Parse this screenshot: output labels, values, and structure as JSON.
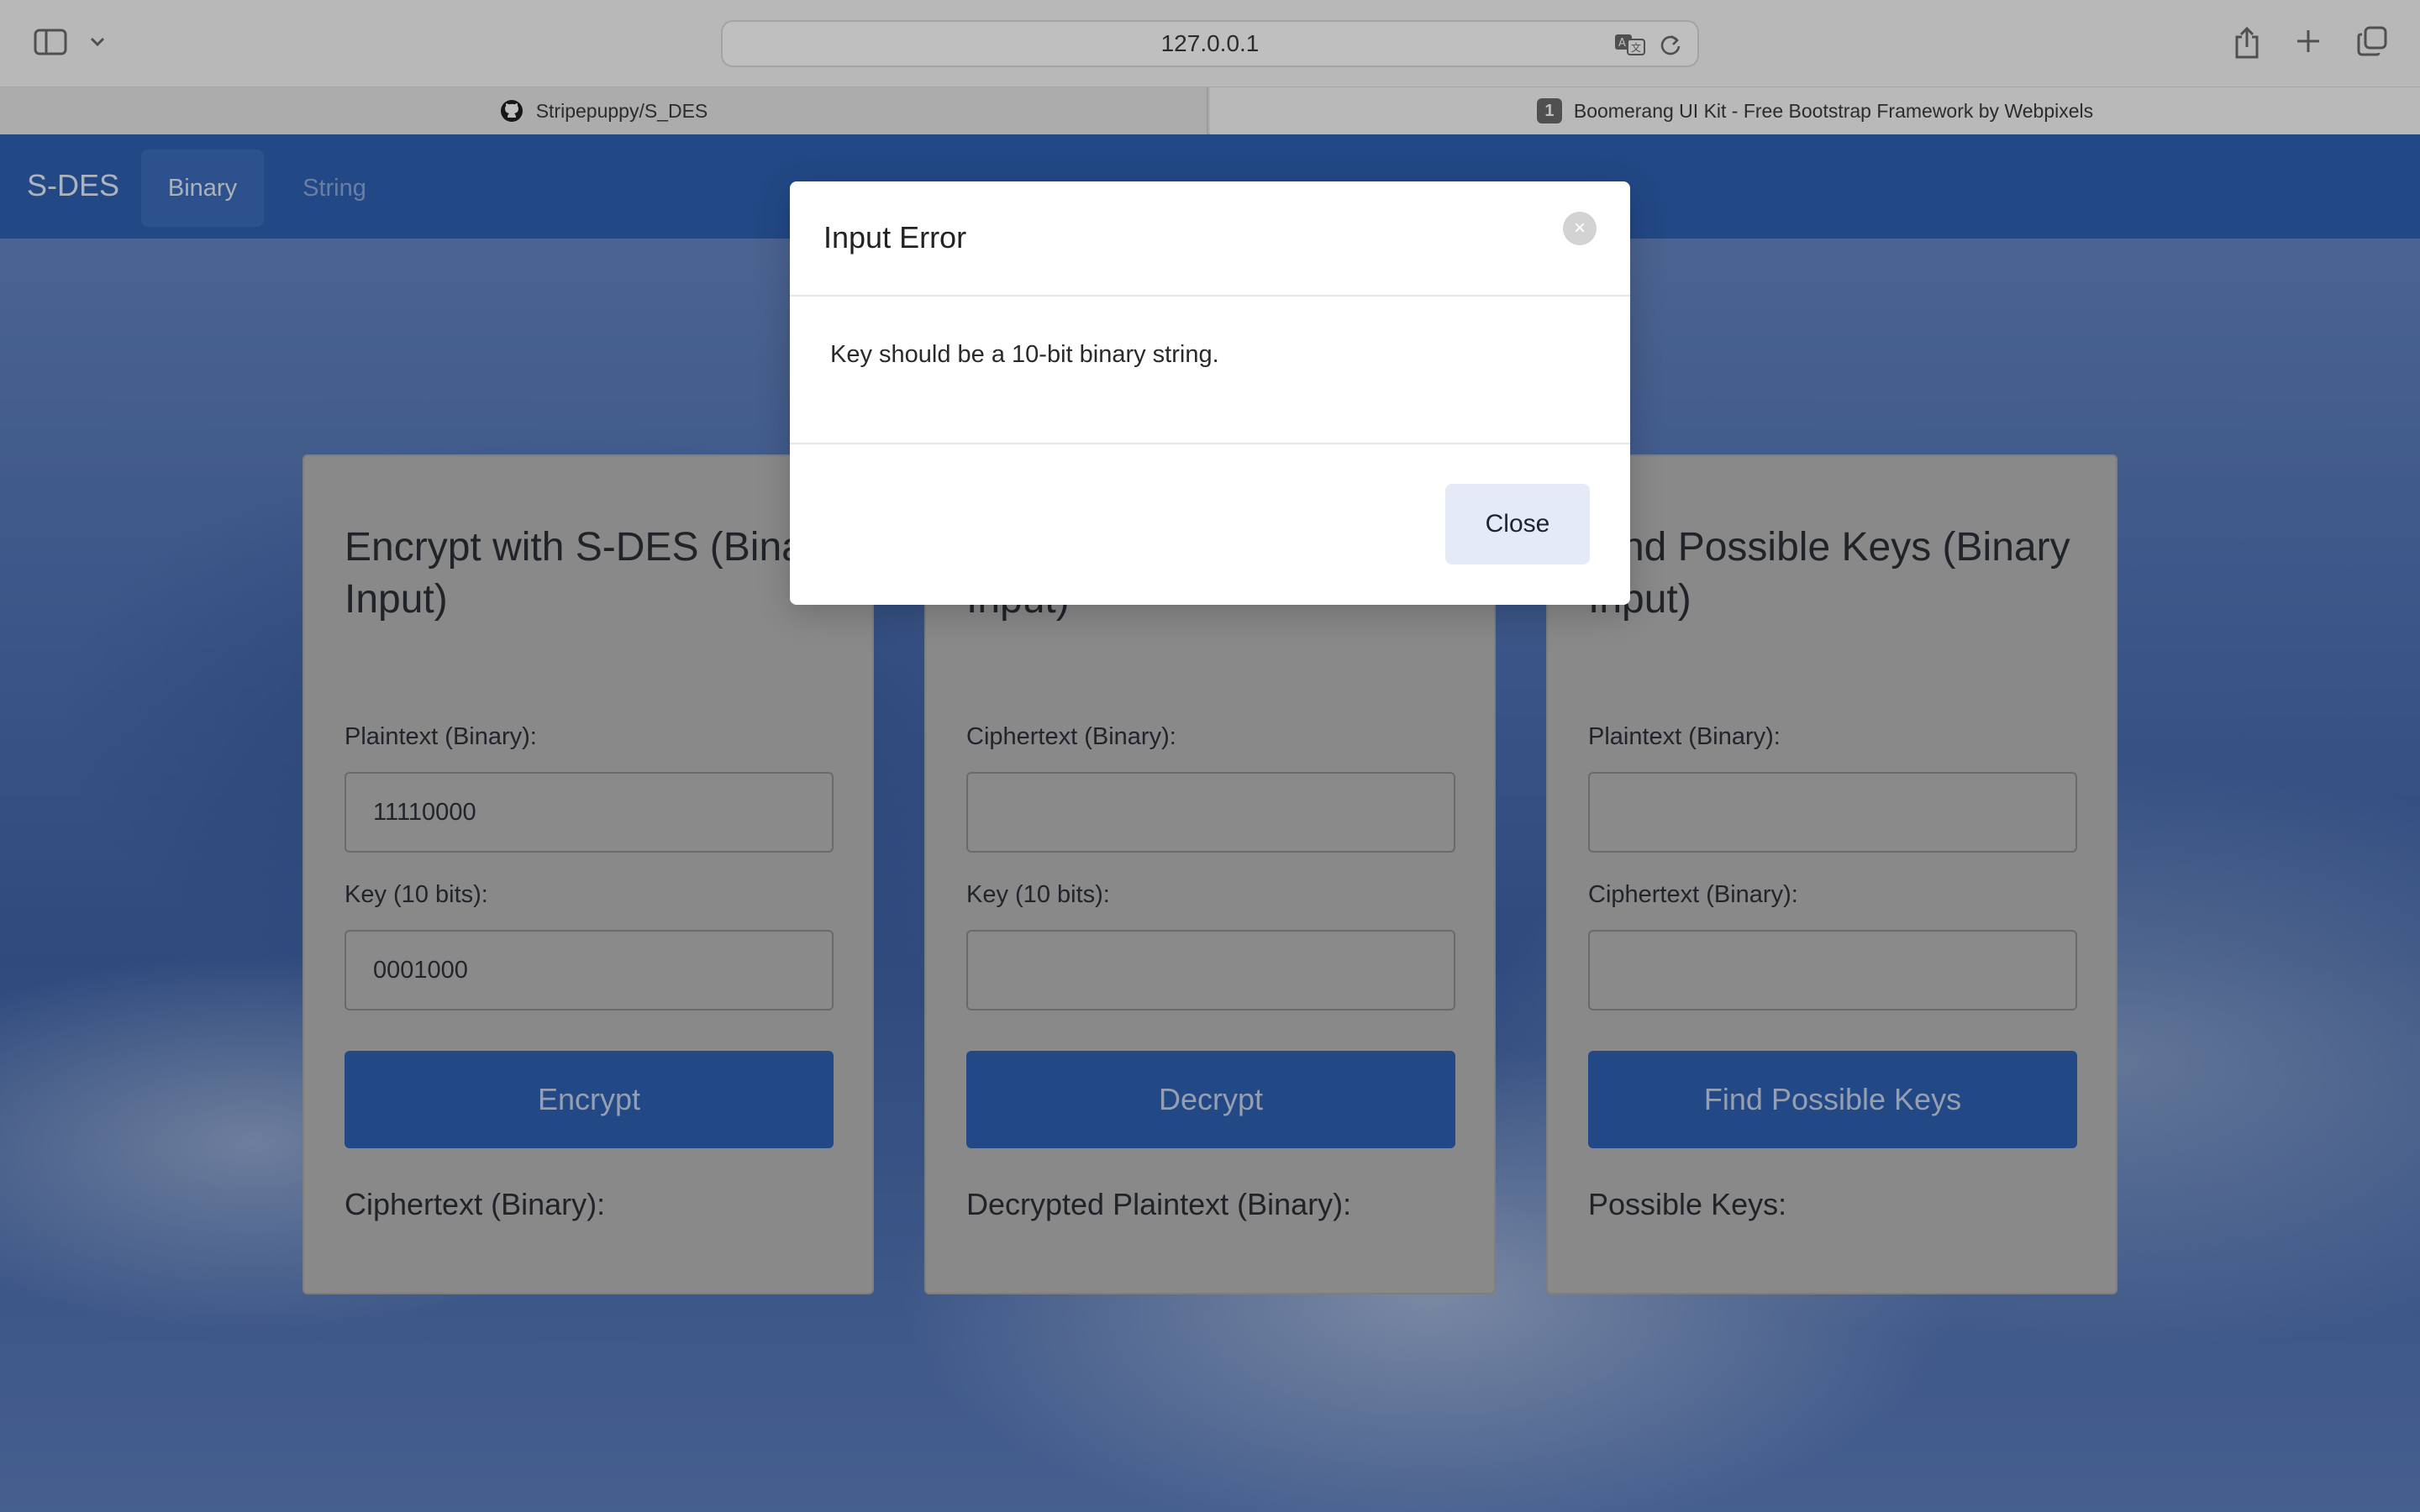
{
  "browser": {
    "url": "127.0.0.1",
    "tabs": [
      {
        "label": "Stripepuppy/S_DES",
        "icon": "github-icon"
      },
      {
        "label": "Boomerang UI Kit - Free Bootstrap Framework by Webpixels",
        "badge": "1"
      }
    ]
  },
  "navbar": {
    "brand": "S-DES",
    "items": [
      {
        "label": "Binary",
        "active": true
      },
      {
        "label": "String",
        "active": false
      }
    ]
  },
  "cards": [
    {
      "title": "Encrypt with S-DES (Binary Input)",
      "field1_label": "Plaintext (Binary):",
      "field1_value": "11110000",
      "field2_label": "Key (10 bits):",
      "field2_value": "0001000",
      "button": "Encrypt",
      "output_label": "Ciphertext (Binary):"
    },
    {
      "title": "Decrypt with S-DES (Binary Input)",
      "field1_label": "Ciphertext (Binary):",
      "field1_value": "",
      "field2_label": "Key (10 bits):",
      "field2_value": "",
      "button": "Decrypt",
      "output_label": "Decrypted Plaintext (Binary):"
    },
    {
      "title": "Find Possible Keys (Binary Input)",
      "field1_label": "Plaintext (Binary):",
      "field1_value": "",
      "field2_label": "Ciphertext (Binary):",
      "field2_value": "",
      "button": "Find Possible Keys",
      "output_label": "Possible Keys:"
    }
  ],
  "modal": {
    "title": "Input Error",
    "x_label": "×",
    "message": "Key should be a 10-bit binary string.",
    "close_label": "Close"
  }
}
